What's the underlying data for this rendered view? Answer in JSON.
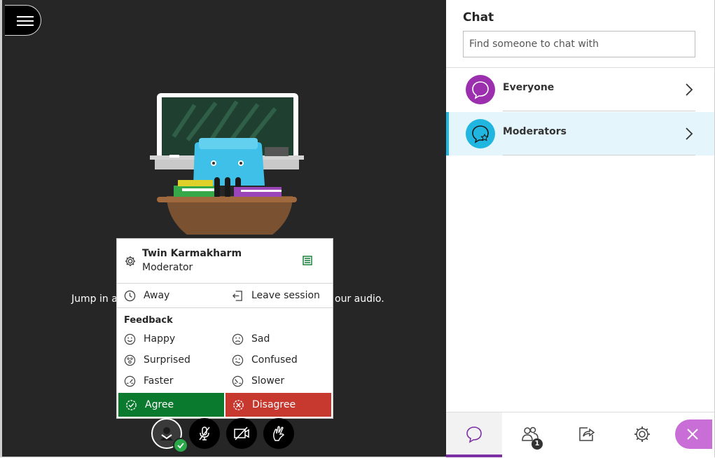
{
  "colors": {
    "stage_bg": "#262626",
    "agree": "#0a7a2f",
    "disagree": "#c7382f",
    "everyone_avatar": "#9b2fae",
    "moderators_avatar": "#21b6e0",
    "active_tab": "#7d2fa6",
    "close": "#c86ed6"
  },
  "stage": {
    "join_text_left": "Jump in ar",
    "join_text_right": "our audio."
  },
  "profile_menu": {
    "name": "Twin Karmakharm",
    "role": "Moderator",
    "away_label": "Away",
    "leave_label": "Leave session",
    "feedback_heading": "Feedback",
    "feedback": {
      "happy": "Happy",
      "sad": "Sad",
      "surprised": "Surprised",
      "confused": "Confused",
      "faster": "Faster",
      "slower": "Slower",
      "agree": "Agree",
      "disagree": "Disagree"
    }
  },
  "chat_panel": {
    "title": "Chat",
    "search_placeholder": "Find someone to chat with",
    "channels": [
      {
        "label": "Everyone",
        "icon": "chat-bubble-icon"
      },
      {
        "label": "Moderators",
        "icon": "moderator-chat-icon",
        "selected": true
      }
    ]
  },
  "tabs": {
    "attendees_badge": "1",
    "items": [
      "chat-icon",
      "attendees-icon",
      "share-content-icon",
      "settings-icon",
      "close-icon"
    ]
  }
}
